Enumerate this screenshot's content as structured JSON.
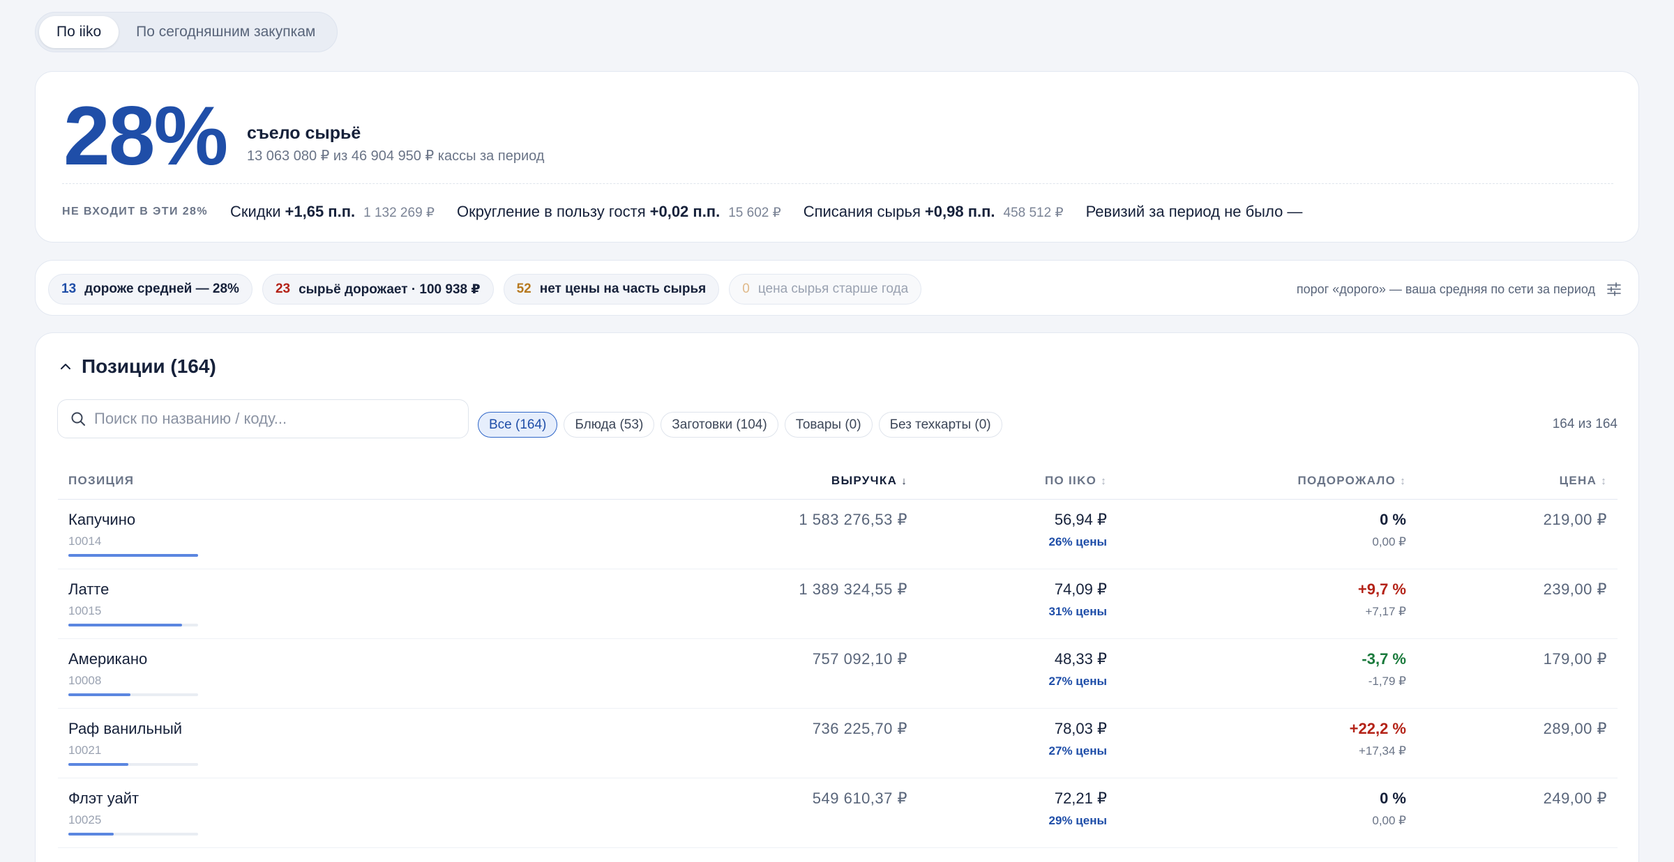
{
  "toggle": {
    "options": [
      "По iiko",
      "По сегодняшним закупкам"
    ],
    "active": "По iiko"
  },
  "summary": {
    "percent": "28%",
    "title": "съело сырьё",
    "subtitle": "13 063 080 ₽ из 46 904 950 ₽ кассы за период",
    "excluded_label": "НЕ ВХОДИТ В ЭТИ 28%",
    "excluded": [
      {
        "label": "Скидки",
        "value": "+1,65 п.п.",
        "amount": "1 132 269 ₽"
      },
      {
        "label": "Округление в пользу гостя",
        "value": "+0,02 п.п.",
        "amount": "15 602 ₽"
      },
      {
        "label": "Списания сырья",
        "value": "+0,98 п.п.",
        "amount": "458 512 ₽"
      },
      {
        "label": "Ревизий за период не было —",
        "value": "",
        "amount": ""
      }
    ]
  },
  "filters": {
    "chips": [
      {
        "count": "13",
        "label": "дороже средней — 28%",
        "color": "#1f4ea8"
      },
      {
        "count": "23",
        "label": "сырьё дорожает · 100 938 ₽",
        "color": "#b42318"
      },
      {
        "count": "52",
        "label": "нет цены на часть сырья",
        "color": "#b7791f"
      },
      {
        "count": "0",
        "label": "цена сырья старше года",
        "color": "#e0b98a"
      }
    ],
    "threshold_text": "порог «дорого» — ваша средняя по сети за период",
    "settings_icon": "sliders-icon"
  },
  "positions": {
    "title": "Позиции (164)",
    "search_placeholder": "Поиск по названию / коду...",
    "tabs": [
      "Все (164)",
      "Блюда (53)",
      "Заготовки (104)",
      "Товары (0)",
      "Без техкарты (0)"
    ],
    "active_tab": "Все (164)",
    "count_text": "164 из 164",
    "columns": {
      "name": "ПОЗИЦИЯ",
      "revenue": "ВЫРУЧКА",
      "iiko": "ПО IIKO",
      "up": "ПОДОРОЖАЛО",
      "price": "ЦЕНА"
    },
    "sorted_by": "revenue",
    "rows": [
      {
        "name": "Капучино",
        "code": "10014",
        "revenue": "1 583 276,53 ₽",
        "iiko": "56,94 ₽",
        "iiko_share": "26% цены",
        "up": "0 %",
        "up_delta": "0,00 ₽",
        "trend": "zero",
        "price": "219,00 ₽",
        "share": 1.0
      },
      {
        "name": "Латте",
        "code": "10015",
        "revenue": "1 389 324,55 ₽",
        "iiko": "74,09 ₽",
        "iiko_share": "31% цены",
        "up": "+9,7 %",
        "up_delta": "+7,17 ₽",
        "trend": "pos",
        "price": "239,00 ₽",
        "share": 0.877
      },
      {
        "name": "Американо",
        "code": "10008",
        "revenue": "757 092,10 ₽",
        "iiko": "48,33 ₽",
        "iiko_share": "27% цены",
        "up": "-3,7 %",
        "up_delta": "-1,79 ₽",
        "trend": "neg",
        "price": "179,00 ₽",
        "share": 0.478
      },
      {
        "name": "Раф ванильный",
        "code": "10021",
        "revenue": "736 225,70 ₽",
        "iiko": "78,03 ₽",
        "iiko_share": "27% цены",
        "up": "+22,2 %",
        "up_delta": "+17,34 ₽",
        "trend": "pos",
        "price": "289,00 ₽",
        "share": 0.465
      },
      {
        "name": "Флэт уайт",
        "code": "10025",
        "revenue": "549 610,37 ₽",
        "iiko": "72,21 ₽",
        "iiko_share": "29% цены",
        "up": "0 %",
        "up_delta": "0,00 ₽",
        "trend": "zero",
        "price": "249,00 ₽",
        "share": 0.347
      }
    ]
  }
}
